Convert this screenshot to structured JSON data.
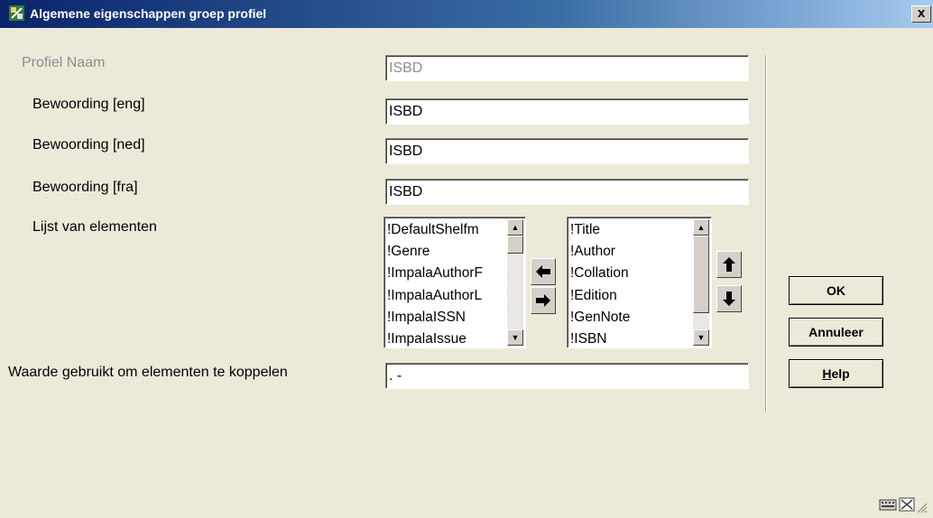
{
  "window": {
    "title": "Algemene eigenschappen groep profiel",
    "close_label": "x"
  },
  "form": {
    "profile_name_label": "Profiel Naam",
    "profile_name_value": "ISBD",
    "wording_eng_label": "Bewoording [eng]",
    "wording_eng_value": "ISBD",
    "wording_ned_label": "Bewoording [ned]",
    "wording_ned_value": "ISBD",
    "wording_fra_label": "Bewoording [fra]",
    "wording_fra_value": "ISBD",
    "elements_label": "Lijst van elementen",
    "available_elements": [
      "!DefaultShelfm",
      "!Genre",
      "!ImpalaAuthorF",
      "!ImpalaAuthorL",
      "!ImpalaISSN",
      "!ImpalaIssue"
    ],
    "selected_elements": [
      "!Title",
      "!Author",
      "!Collation",
      "!Edition",
      "!GenNote",
      "!ISBN"
    ],
    "join_value_label": "Waarde gebruikt om elementen te koppelen",
    "join_value": ". -"
  },
  "buttons": {
    "ok": "OK",
    "cancel": "Annuleer",
    "help_mnemonic": "H",
    "help_rest": "elp"
  },
  "icons": {
    "move_left": "arrow-left-icon",
    "move_right": "arrow-right-icon",
    "move_up": "arrow-up-icon",
    "move_down": "arrow-down-icon"
  }
}
